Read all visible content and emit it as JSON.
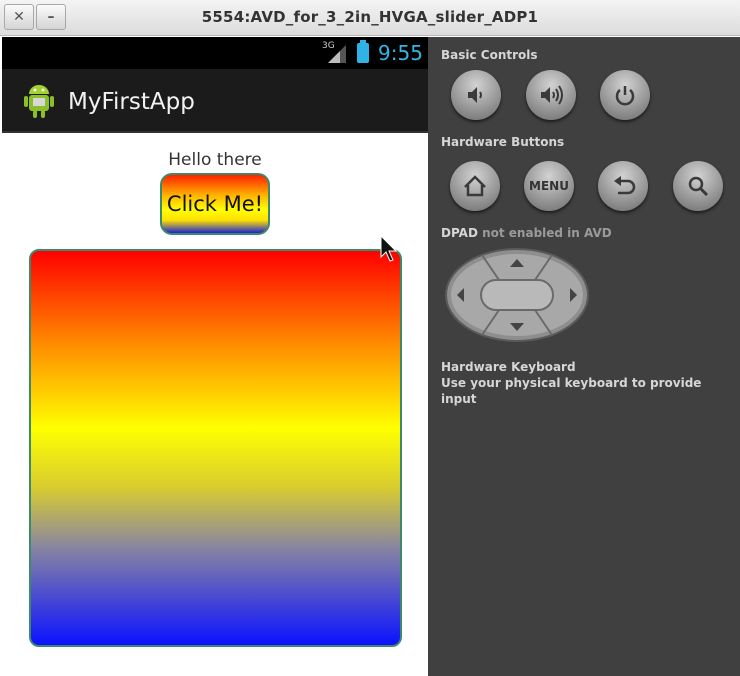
{
  "window": {
    "title": "5554:AVD_for_3_2in_HVGA_slider_ADP1",
    "close_glyph": "✕",
    "minimize_glyph": "–"
  },
  "status_bar": {
    "network_label": "3G",
    "time": "9:55",
    "icons": [
      "signal-icon",
      "battery-icon"
    ]
  },
  "action_bar": {
    "app_title": "MyFirstApp",
    "app_icon": "android-icon"
  },
  "content": {
    "greeting": "Hello there",
    "button_label": "Click Me!"
  },
  "controls": {
    "basic_controls_title": "Basic Controls",
    "basic_controls": [
      "volume-down-icon",
      "volume-up-icon",
      "power-icon"
    ],
    "hardware_buttons_title": "Hardware Buttons",
    "hardware_buttons": [
      "home-icon",
      "MENU",
      "back-icon",
      "search-icon"
    ],
    "menu_label": "MENU",
    "dpad_title": "DPAD",
    "dpad_note": "not enabled in AVD",
    "keyboard_title": "Hardware Keyboard",
    "keyboard_note": "Use your physical keyboard to provide input"
  },
  "colors": {
    "status_accent": "#33b5e5",
    "panel_bg": "#404040",
    "gradient_top": "#ff0000",
    "gradient_mid": "#ffff00",
    "gradient_bottom": "#0b12ff",
    "border": "#3b8a6a"
  }
}
